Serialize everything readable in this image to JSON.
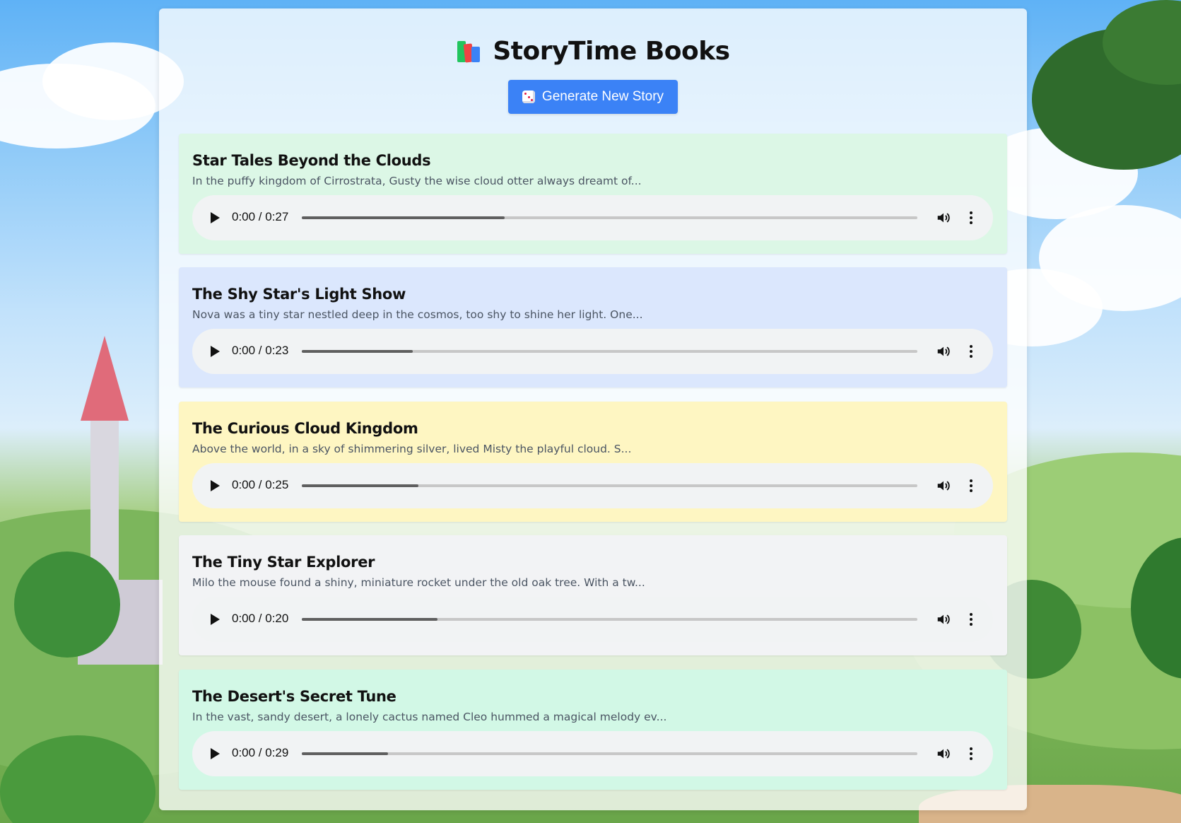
{
  "header": {
    "title": "StoryTime Books",
    "logo_icon": "books-icon"
  },
  "toolbar": {
    "generate_label": "Generate New Story",
    "generate_icon": "dice-icon",
    "accent_color": "#3b82f6"
  },
  "stories": [
    {
      "title": "Star Tales Beyond the Clouds",
      "excerpt": "In the puffy kingdom of Cirrostrata, Gusty the wise cloud otter always dreamt of...",
      "time": "0:00 / 0:27",
      "progress": 0.33,
      "bg_color": "#dcf7e6"
    },
    {
      "title": "The Shy Star's Light Show",
      "excerpt": "Nova was a tiny star nestled deep in the cosmos, too shy to shine her light. One...",
      "time": "0:00 / 0:23",
      "progress": 0.18,
      "bg_color": "#dbe7fd"
    },
    {
      "title": "The Curious Cloud Kingdom",
      "excerpt": "Above the world, in a sky of shimmering silver, lived Misty the playful cloud. S...",
      "time": "0:00 / 0:25",
      "progress": 0.19,
      "bg_color": "#fef6c2"
    },
    {
      "title": "The Tiny Star Explorer",
      "excerpt": "Milo the mouse found a shiny, miniature rocket under the old oak tree. With a tw...",
      "time": "0:00 / 0:20",
      "progress": 0.22,
      "bg_color": "#f2f3f5"
    },
    {
      "title": "The Desert's Secret Tune",
      "excerpt": "In the vast, sandy desert, a lonely cactus named Cleo hummed a magical melody ev...",
      "time": "0:00 / 0:29",
      "progress": 0.14,
      "bg_color": "#d2f8e6"
    }
  ]
}
